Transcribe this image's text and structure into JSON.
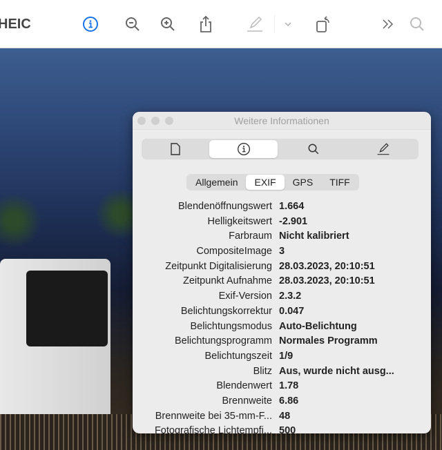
{
  "toolbar": {
    "title": "HEIC",
    "icons": [
      "info-icon",
      "zoom-out-icon",
      "zoom-in-icon",
      "share-icon",
      "markup-icon",
      "chevron-down-icon",
      "rotate-icon",
      "more-icon",
      "search-icon"
    ],
    "accent": "#1a73e8"
  },
  "panel": {
    "title": "Weitere Informationen",
    "segments": [
      "document-icon",
      "info-icon",
      "search-icon",
      "markup-icon"
    ],
    "tabs": [
      "Allgemein",
      "EXIF",
      "GPS",
      "TIFF"
    ],
    "selected_tab": "EXIF",
    "rows": [
      {
        "label": "Blendenöffnungswert",
        "value": "1.664"
      },
      {
        "label": "Helligkeitswert",
        "value": "-2.901"
      },
      {
        "label": "Farbraum",
        "value": "Nicht kalibriert"
      },
      {
        "label": "CompositeImage",
        "value": "3"
      },
      {
        "label": "Zeitpunkt Digitalisierung",
        "value": "28.03.2023, 20:10:51"
      },
      {
        "label": "Zeitpunkt Aufnahme",
        "value": "28.03.2023, 20:10:51"
      },
      {
        "label": "Exif-Version",
        "value": "2.3.2"
      },
      {
        "label": "Belichtungskorrektur",
        "value": "0.047"
      },
      {
        "label": "Belichtungsmodus",
        "value": "Auto-Belichtung"
      },
      {
        "label": "Belichtungsprogramm",
        "value": "Normales Programm"
      },
      {
        "label": "Belichtungszeit",
        "value": "1/9"
      },
      {
        "label": "Blitz",
        "value": "Aus, wurde nicht ausg..."
      },
      {
        "label": "Blendenwert",
        "value": "1.78"
      },
      {
        "label": "Brennweite",
        "value": "6.86"
      },
      {
        "label": "Brennweite bei 35-mm-F...",
        "value": "48"
      },
      {
        "label": "Fotografische Lichtempfi...",
        "value": "500"
      }
    ]
  }
}
